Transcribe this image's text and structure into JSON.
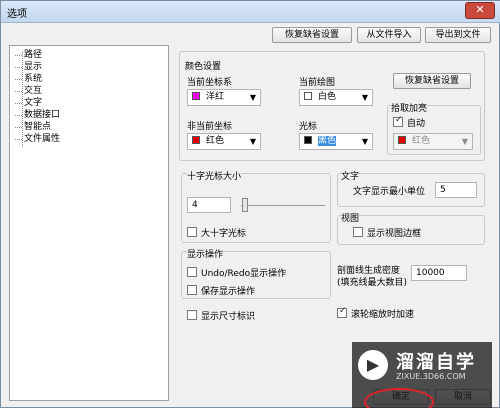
{
  "window": {
    "title": "选项",
    "close_glyph": "✕"
  },
  "toolbar": {
    "restore_default_label": "恢复缺省设置",
    "import_label": "从文件导入",
    "export_label": "导出到文件"
  },
  "nav": {
    "items": [
      "路径",
      "显示",
      "系统",
      "交互",
      "文字",
      "数据接口",
      "智能点",
      "文件属性"
    ]
  },
  "color_settings": {
    "title": "颜色设置",
    "current_axis": {
      "label": "当前坐标系",
      "value": "洋红",
      "color": "#ff00ff"
    },
    "current_drawing": {
      "label": "当前绘图",
      "value": "白色",
      "color": "#ffffff"
    },
    "restore_button": "恢复缺省设置",
    "noncurrent_axis": {
      "label": "非当前坐标",
      "value": "红色",
      "color": "#e00000"
    },
    "cursor": {
      "label": "光标",
      "value": "黑色",
      "color": "#000000"
    },
    "pick_highlight": {
      "title": "拾取加亮",
      "auto_label": "自动",
      "auto_checked": true,
      "value": "红色",
      "color": "#e00000"
    }
  },
  "crosshair": {
    "title": "十字光标大小",
    "size_value": "4",
    "slider_fraction": 0.04,
    "big_label": "大十字光标",
    "big_checked": false
  },
  "text": {
    "title": "文字",
    "min_unit_label": "文字显示最小单位",
    "min_unit_value": "5"
  },
  "view": {
    "title": "视图",
    "show_border_label": "显示视图边框",
    "show_border_checked": false
  },
  "display_ops": {
    "title": "显示操作",
    "undo_redo_label": "Undo/Redo显示操作",
    "undo_redo_checked": false,
    "save_label": "保存显示操作",
    "save_checked": false
  },
  "hatch": {
    "label_line1": "剖面线生成密度",
    "label_line2": "(填充线最大数目)",
    "value": "10000"
  },
  "show_dim_label": "显示尺寸标识",
  "show_dim_checked": false,
  "wheel_zoom_label": "滚轮缩放时加速",
  "wheel_zoom_checked": true,
  "footer": {
    "ok_label": "确定",
    "cancel_label": "取消"
  },
  "watermark": {
    "logo_glyph": "▶",
    "title": "溜溜自学",
    "url": "ZIXUE.3D66.COM"
  }
}
